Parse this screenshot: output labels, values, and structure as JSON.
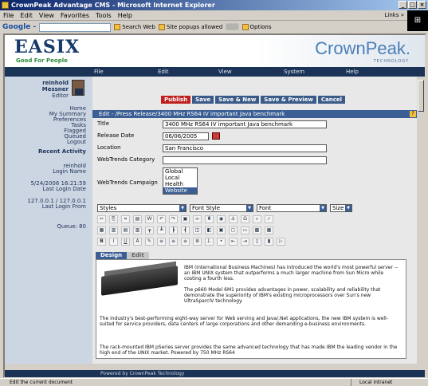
{
  "window": {
    "title": "CrownPeak Advantage CMS - Microsoft Internet Explorer",
    "buttons": [
      "_",
      "□",
      "×"
    ]
  },
  "menubar": {
    "items": [
      "File",
      "Edit",
      "View",
      "Favorites",
      "Tools",
      "Help"
    ],
    "links": "Links »"
  },
  "google": {
    "logo": "Google -",
    "search_web": "Search Web",
    "popups": "Site popups allowed",
    "options": "Options"
  },
  "header": {
    "brand": "EASIX",
    "tagline": "Good For People",
    "cms_brand": "CrownPeak.",
    "cms_tagline": "TECHNOLOGY"
  },
  "nav": {
    "items": [
      "File",
      "Edit",
      "View",
      "System",
      "Help"
    ]
  },
  "sidebar": {
    "user_first": "reinhold",
    "user_last": "Messner",
    "role": "Editor",
    "links": [
      "Home",
      "My Summary",
      "Preferences",
      "Tasks",
      "Flagged",
      "Queued",
      "Logout"
    ],
    "recent_heading": "Recent Activity",
    "login_name_value": "reinhold",
    "login_name_label": "Login Name",
    "login_date_value": "5/24/2006 16:21:59",
    "login_date_label": "Last Login Date",
    "login_from_value": "127.0.0.1 / 127.0.0.1",
    "login_from_label": "Last Login From",
    "queue": "Queue: 80"
  },
  "toolbar": {
    "publish": "Publish",
    "save": "Save",
    "save_new": "Save & New",
    "save_preview": "Save & Preview",
    "cancel": "Cancel"
  },
  "edit": {
    "breadcrumb": "Edit - /Press Release/3400 MHz RS64 IV important Java benchmark",
    "help": "?"
  },
  "form": {
    "title_label": "Title",
    "title_value": "3400 MHz RS64 IV important Java benchmark",
    "date_label": "Release Date",
    "date_value": "06/06/2005",
    "location_label": "Location",
    "location_value": "San Francisco",
    "category_label": "WebTrends Category",
    "category_value": "",
    "campaign_label": "WebTrends Campaign",
    "campaign_options": [
      "Global",
      "Local",
      "Health",
      "Website"
    ],
    "campaign_selected": "Website"
  },
  "format": {
    "styles": "Styles",
    "font_style": "Font Style",
    "font": "Font",
    "size": "Size"
  },
  "tabs": {
    "design": "Design",
    "edit": "Edit"
  },
  "editor": {
    "p1": "IBM (International Business Machines) has introduced the world's most powerful server -- an IBM UNIX system that outperforms a much larger machine from Sun Micro while costing a fourth less.",
    "p2": "The p660 Model 6M1 provides advantages in power, scalability and reliability that demonstrate the superiority of IBM's existing microprocessors over Sun's new UltraSparcIV technology.",
    "p3": "The industry's best-performing eight-way server for Web serving and Java/.Net applications, the new IBM system is well-suited for service providers, data centers of large corporations and other demanding e-business environments.",
    "p4": "The rack-mounted IBM pSeries server provides the same advanced technology that has made IBM the leading vendor in the high end of the UNIX market. Powered by 750 MHz RS64"
  },
  "footer": {
    "text": "Powered by CrownPeak Technology"
  },
  "status": {
    "left": "Edit the current document",
    "right": "Local intranet"
  }
}
